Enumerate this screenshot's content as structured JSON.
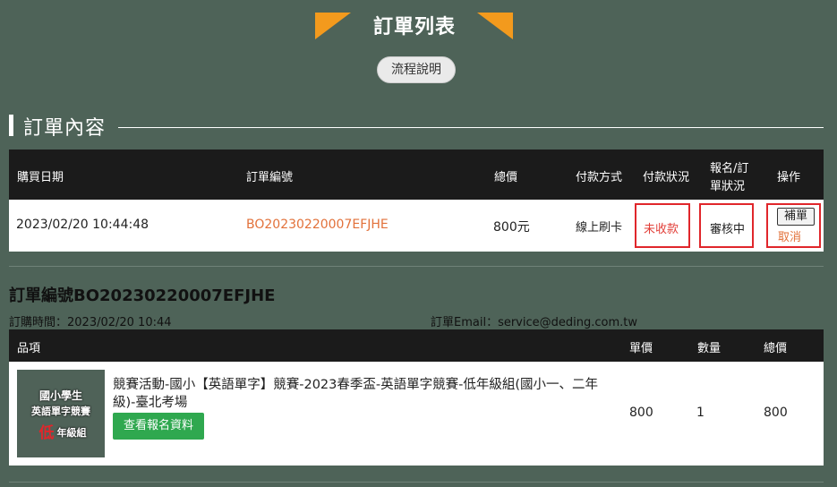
{
  "header": {
    "title": "訂單列表",
    "flow_button": "流程說明"
  },
  "section": {
    "title": "訂單內容"
  },
  "orders": {
    "columns": [
      "購買日期",
      "訂單編號",
      "總價",
      "付款方式",
      "付款狀況",
      "報名/訂",
      "單狀況",
      "操作"
    ],
    "row": {
      "date": "2023/02/20 10:44:48",
      "order_no": "BO20230220007EFJHE",
      "total": "800元",
      "payment_method": "線上刷卡",
      "payment_status": "未收款",
      "order_status": "審核中",
      "supplement_button": "補單",
      "cancel_link": "取消"
    }
  },
  "detail": {
    "title": "訂單編號BO20230220007EFJHE",
    "order_time": "訂購時間：2023/02/20 10:44",
    "order_email": "訂單Email：service@deding.com.tw",
    "columns": [
      "品項",
      "單價",
      "數量",
      "總價"
    ],
    "item": {
      "thumb_text": [
        "國小學生",
        "英語單字競賽",
        "低",
        "年級組"
      ],
      "name": "競賽活動-國小【英語單字】競賽-2023春季盃-英語單字競賽-低年級組(國小一、二年級)-臺北考場",
      "view_button": "查看報名資料",
      "unit_price": "800",
      "quantity": "1",
      "subtotal": "800"
    }
  },
  "colors": {
    "background": "#4e6358",
    "accent_orange": "#f39a1d",
    "header_black": "#1b1b1b",
    "link_orange": "#e2713a",
    "highlight_red": "#e0262b",
    "button_green": "#2fa84f"
  }
}
